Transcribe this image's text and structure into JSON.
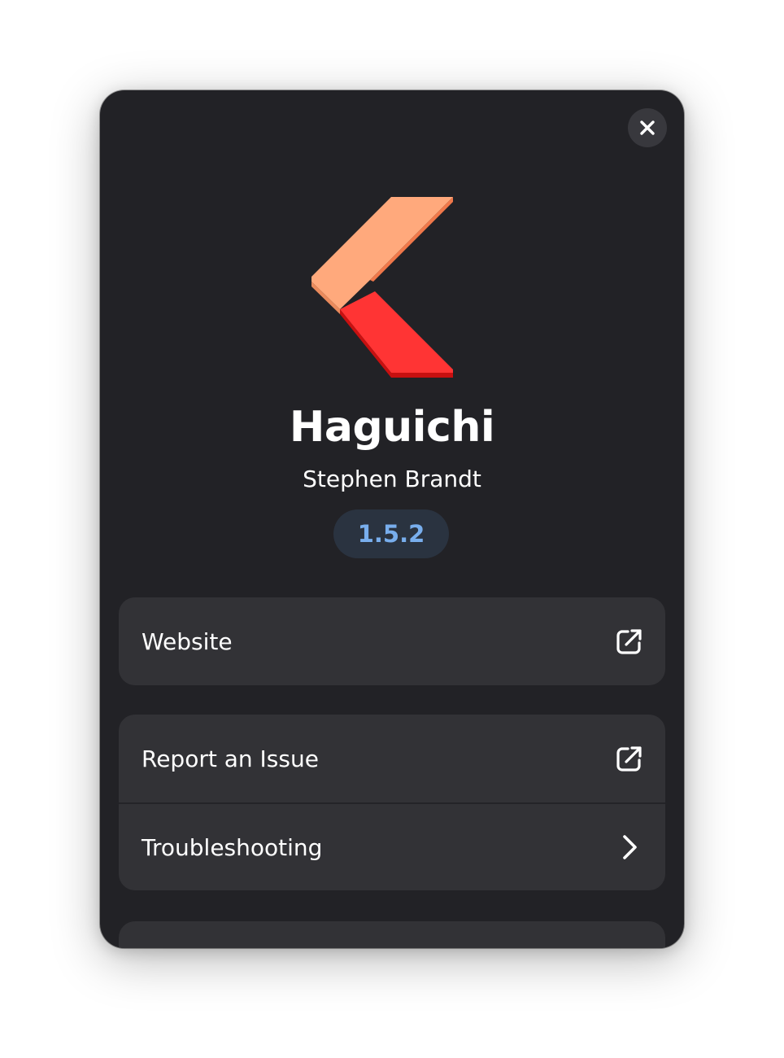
{
  "app": {
    "name": "Haguichi",
    "developer": "Stephen Brandt",
    "version": "1.5.2"
  },
  "links": [
    {
      "label": "Website",
      "icon": "external-link-icon"
    }
  ],
  "support": [
    {
      "label": "Report an Issue",
      "icon": "external-link-icon"
    },
    {
      "label": "Troubleshooting",
      "icon": "chevron-right-icon"
    }
  ],
  "colors": {
    "dialog_bg": "#222226",
    "row_bg": "#323236",
    "accent": "#78aeed",
    "logo_peach": "#ffa97c",
    "logo_red": "#ff3232"
  },
  "icons": {
    "close": "close-icon",
    "logo": "haguichi-logo"
  }
}
